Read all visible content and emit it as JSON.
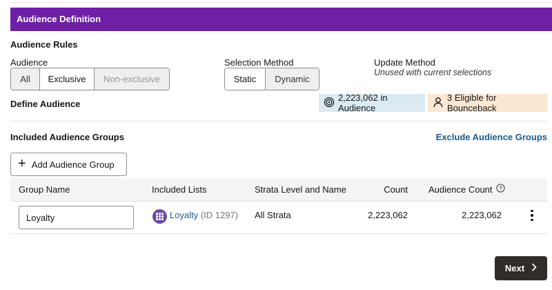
{
  "header": {
    "title": "Audience Definition"
  },
  "rules": {
    "title": "Audience Rules",
    "audience": {
      "label": "Audience",
      "options": [
        "All",
        "Exclusive",
        "Non-exclusive"
      ],
      "selected": "Exclusive"
    },
    "selection_method": {
      "label": "Selection Method",
      "options": [
        "Static",
        "Dynamic"
      ],
      "selected": "Static"
    },
    "update_method": {
      "label": "Update Method",
      "subtext": "Unused with current selections"
    }
  },
  "define": {
    "title": "Define Audience",
    "in_audience": "2,223,062 in Audience",
    "eligible": "3 Eligible for Bounceback",
    "badge_colors": {
      "in_audience_bg": "#dbeaf3",
      "eligible_bg": "#fbe7d3"
    }
  },
  "groups": {
    "title": "Included Audience Groups",
    "exclude_link": "Exclude Audience Groups",
    "add_button": "Add Audience Group",
    "columns": [
      "Group Name",
      "Included Lists",
      "Strata Level and Name",
      "Count",
      "Audience Count"
    ],
    "rows": [
      {
        "group_name": "Loyalty",
        "list_name": "Loyalty",
        "list_id": "(ID 1297)",
        "strata": "All Strata",
        "count": "2,223,062",
        "audience_count": "2,223,062"
      }
    ]
  },
  "footer": {
    "next_label": "Next"
  },
  "colors": {
    "header_bg": "#6e1fa6",
    "link": "#1d5a86",
    "primary_button": "#312d2a"
  }
}
